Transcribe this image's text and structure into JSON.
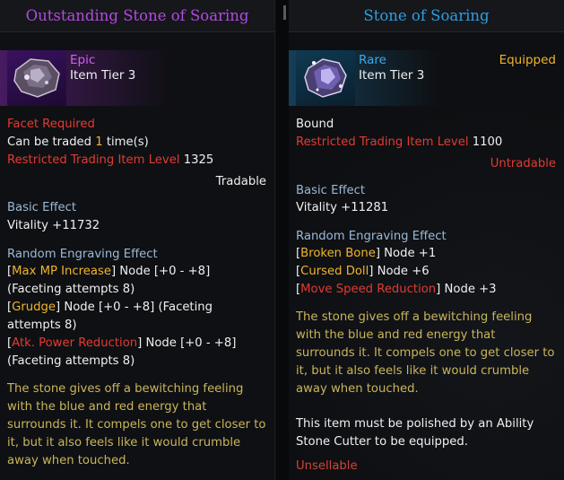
{
  "left": {
    "title": "Outstanding Stone of Soaring",
    "grade": "Epic",
    "tier": "Item Tier 3",
    "facet_required": "Facet Required",
    "trade_prefix": "Can be traded ",
    "trade_count": "1",
    "trade_suffix": " time(s)",
    "restricted_label": "Restricted Trading Item Level",
    "restricted_value": "1325",
    "tradable": "Tradable",
    "basic_effect_header": "Basic Effect",
    "basic_effect": "Vitality +11732",
    "random_header": "Random Engraving Effect",
    "engravings": [
      {
        "name": "Max MP Increase",
        "node": "Node [+0 - +8]",
        "attempts": "(Faceting attempts 8)",
        "color": "#f0b52a"
      },
      {
        "name": "Grudge",
        "node": "Node [+0 - +8] (Faceting",
        "attempts": "attempts 8)",
        "color": "#f0b52a"
      },
      {
        "name": "Atk. Power Reduction",
        "node": "Node [+0 - +8]",
        "attempts": "(Faceting attempts 8)",
        "color": "#e43a32"
      }
    ],
    "description": "The stone gives off a bewitching feeling with the blue and red energy that surrounds it. It compels one to get closer to it, but it also feels like it would crumble away when touched."
  },
  "right": {
    "title": "Stone of Soaring",
    "grade": "Rare",
    "tier": "Item Tier 3",
    "equipped": "Equipped",
    "bound": "Bound",
    "restricted_label": "Restricted Trading Item Level",
    "restricted_value": "1100",
    "untradable": "Untradable",
    "basic_effect_header": "Basic Effect",
    "basic_effect": "Vitality +11281",
    "random_header": "Random Engraving Effect",
    "engravings": [
      {
        "name": "Broken Bone",
        "node": "Node +1",
        "color": "#f0b52a"
      },
      {
        "name": "Cursed Doll",
        "node": "Node +6",
        "color": "#f0b52a"
      },
      {
        "name": "Move Speed Reduction",
        "node": "Node +3",
        "color": "#e43a32"
      }
    ],
    "description": "The stone gives off a bewitching feeling with the blue and red energy that surrounds it. It compels one to get closer to it, but it also feels like it would crumble away when touched.",
    "polish_note": "This item must be polished by an Ability Stone Cutter to be equipped.",
    "unsellable": "Unsellable"
  },
  "icons": [
    "epic-ability-stone-icon",
    "rare-ability-stone-icon"
  ]
}
